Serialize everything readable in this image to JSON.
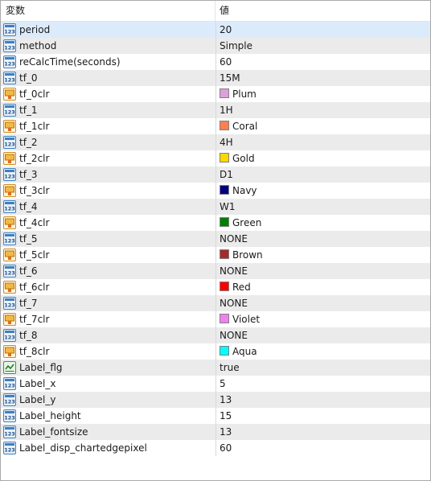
{
  "header": {
    "name_col": "変数",
    "value_col": "値"
  },
  "rows": [
    {
      "name": "period",
      "value": "20",
      "icon": "int-icon",
      "selected": true
    },
    {
      "name": "method",
      "value": "Simple",
      "icon": "int-icon"
    },
    {
      "name": "reCalcTime(seconds)",
      "value": "60",
      "icon": "int-icon"
    },
    {
      "name": "tf_0",
      "value": "15M",
      "icon": "int-icon"
    },
    {
      "name": "tf_0clr",
      "value": "Plum",
      "icon": "color-icon",
      "color": "#DDA0DD"
    },
    {
      "name": "tf_1",
      "value": "1H",
      "icon": "int-icon"
    },
    {
      "name": "tf_1clr",
      "value": "Coral",
      "icon": "color-icon",
      "color": "#FF7F50"
    },
    {
      "name": "tf_2",
      "value": "4H",
      "icon": "int-icon"
    },
    {
      "name": "tf_2clr",
      "value": "Gold",
      "icon": "color-icon",
      "color": "#FFD700"
    },
    {
      "name": "tf_3",
      "value": "D1",
      "icon": "int-icon"
    },
    {
      "name": "tf_3clr",
      "value": "Navy",
      "icon": "color-icon",
      "color": "#000080"
    },
    {
      "name": "tf_4",
      "value": "W1",
      "icon": "int-icon"
    },
    {
      "name": "tf_4clr",
      "value": "Green",
      "icon": "color-icon",
      "color": "#008000"
    },
    {
      "name": "tf_5",
      "value": "NONE",
      "icon": "int-icon"
    },
    {
      "name": "tf_5clr",
      "value": "Brown",
      "icon": "color-icon",
      "color": "#A52A2A"
    },
    {
      "name": "tf_6",
      "value": "NONE",
      "icon": "int-icon"
    },
    {
      "name": "tf_6clr",
      "value": "Red",
      "icon": "color-icon",
      "color": "#FF0000"
    },
    {
      "name": "tf_7",
      "value": "NONE",
      "icon": "int-icon"
    },
    {
      "name": "tf_7clr",
      "value": "Violet",
      "icon": "color-icon",
      "color": "#EE82EE"
    },
    {
      "name": "tf_8",
      "value": "NONE",
      "icon": "int-icon"
    },
    {
      "name": "tf_8clr",
      "value": "Aqua",
      "icon": "color-icon",
      "color": "#00FFFF"
    },
    {
      "name": "Label_flg",
      "value": "true",
      "icon": "bool-icon"
    },
    {
      "name": "Label_x",
      "value": "5",
      "icon": "int-icon"
    },
    {
      "name": "Label_y",
      "value": "13",
      "icon": "int-icon"
    },
    {
      "name": "Label_height",
      "value": "15",
      "icon": "int-icon"
    },
    {
      "name": "Label_fontsize",
      "value": "13",
      "icon": "int-icon"
    },
    {
      "name": "Label_disp_chartedgepixel",
      "value": "60",
      "icon": "int-icon"
    }
  ]
}
